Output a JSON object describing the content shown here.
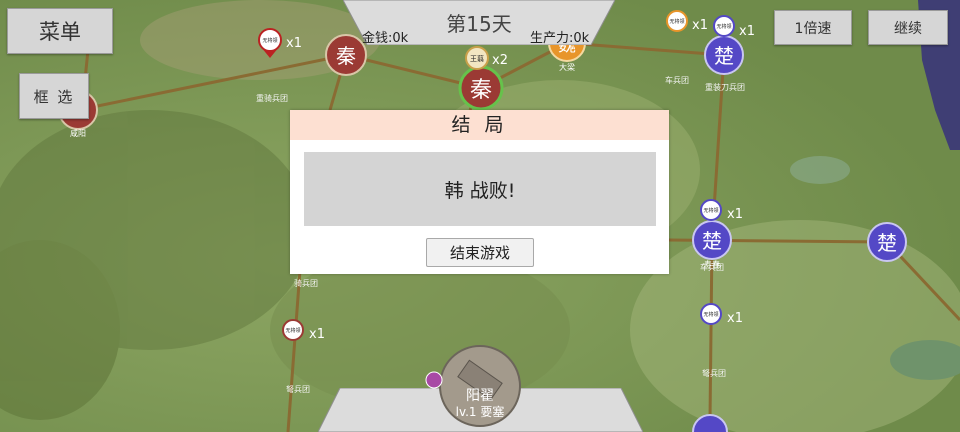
{
  "hud": {
    "menu_label": "菜单",
    "filter_label": "框 选",
    "speed_label": "1倍速",
    "continue_label": "继续",
    "day_label": "第15天",
    "money_label": "金钱:0k",
    "production_label": "生产力:0k"
  },
  "modal": {
    "title": "结 局",
    "message": "韩 战败!",
    "end_button": "结束游戏"
  },
  "cities": [
    {
      "name": "秦",
      "sub": "咸阳",
      "color": "#9b3a34"
    },
    {
      "name": "秦",
      "sub": "",
      "color": "#9b3a34"
    },
    {
      "name": "秦",
      "sub": "",
      "color": "#9b3a34"
    },
    {
      "name": "魏",
      "sub": "大梁",
      "color": "#e8952a"
    },
    {
      "name": "楚",
      "sub": "",
      "color": "#5448c6"
    },
    {
      "name": "楚",
      "sub": "寿春",
      "color": "#5448c6"
    },
    {
      "name": "楚",
      "sub": "",
      "color": "#5448c6"
    },
    {
      "name": "楚",
      "sub": "",
      "color": "#5448c6"
    }
  ],
  "units": [
    {
      "label": "无将领",
      "count": "x1"
    },
    {
      "label": "王翦",
      "count": "x2"
    },
    {
      "label": "无将领",
      "count": "x1"
    },
    {
      "label": "无将领",
      "count": "x1"
    },
    {
      "label": "无将领",
      "count": "x1"
    },
    {
      "label": "无将领",
      "count": "x1"
    },
    {
      "label": "无将领",
      "count": "x1"
    }
  ],
  "map_labels": [
    "重骑兵团",
    "车兵团",
    "重装刀兵团",
    "车兵团",
    "骑兵团",
    "弩兵团",
    "弩兵团",
    "咸阳",
    "大梁",
    "寿春"
  ],
  "fort": {
    "name": "阳翟",
    "level": "lv.1 要塞"
  },
  "colors": {
    "qin": "#9b3a34",
    "wei": "#e8952a",
    "chu": "#5448c6",
    "roads": "#8a6b33",
    "sea": "#3f3e74"
  }
}
